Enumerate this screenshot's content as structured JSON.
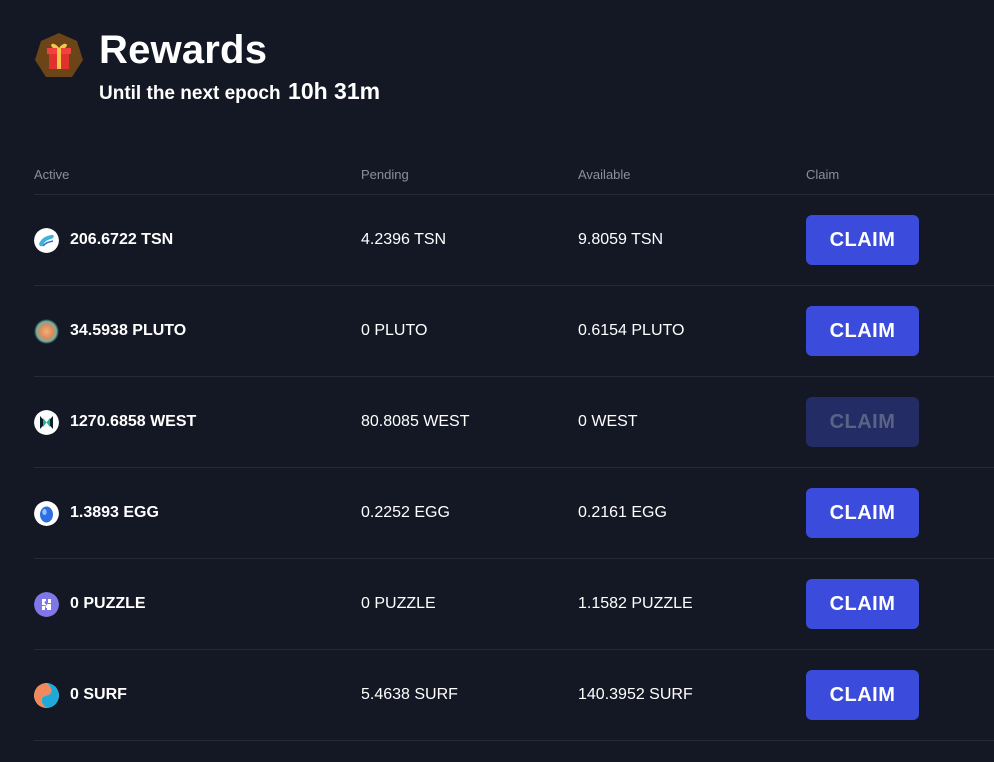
{
  "header": {
    "title": "Rewards",
    "subtitle_label": "Until the next epoch",
    "timer": "10h 31m",
    "icon": "gift-icon"
  },
  "table": {
    "columns": [
      "Active",
      "Pending",
      "Available",
      "Claim"
    ],
    "rows": [
      {
        "icon": "tsn-token-icon",
        "active": "206.6722 TSN",
        "pending": "4.2396 TSN",
        "available": "9.8059 TSN",
        "claim_label": "CLAIM",
        "claim_enabled": true
      },
      {
        "icon": "pluto-token-icon",
        "active": "34.5938 PLUTO",
        "pending": "0 PLUTO",
        "available": "0.6154 PLUTO",
        "claim_label": "CLAIM",
        "claim_enabled": true
      },
      {
        "icon": "west-token-icon",
        "active": "1270.6858 WEST",
        "pending": "80.8085 WEST",
        "available": "0 WEST",
        "claim_label": "CLAIM",
        "claim_enabled": false
      },
      {
        "icon": "egg-token-icon",
        "active": "1.3893 EGG",
        "pending": "0.2252 EGG",
        "available": "0.2161 EGG",
        "claim_label": "CLAIM",
        "claim_enabled": true
      },
      {
        "icon": "puzzle-token-icon",
        "active": "0 PUZZLE",
        "pending": "0 PUZZLE",
        "available": "1.1582 PUZZLE",
        "claim_label": "CLAIM",
        "claim_enabled": true
      },
      {
        "icon": "surf-token-icon",
        "active": "0 SURF",
        "pending": "5.4638 SURF",
        "available": "140.3952 SURF",
        "claim_label": "CLAIM",
        "claim_enabled": true
      }
    ]
  },
  "colors": {
    "background": "#141824",
    "button": "#3b4bdb",
    "button_disabled": "#242c66",
    "muted_text": "#8a8f9c",
    "divider": "#262b38"
  }
}
